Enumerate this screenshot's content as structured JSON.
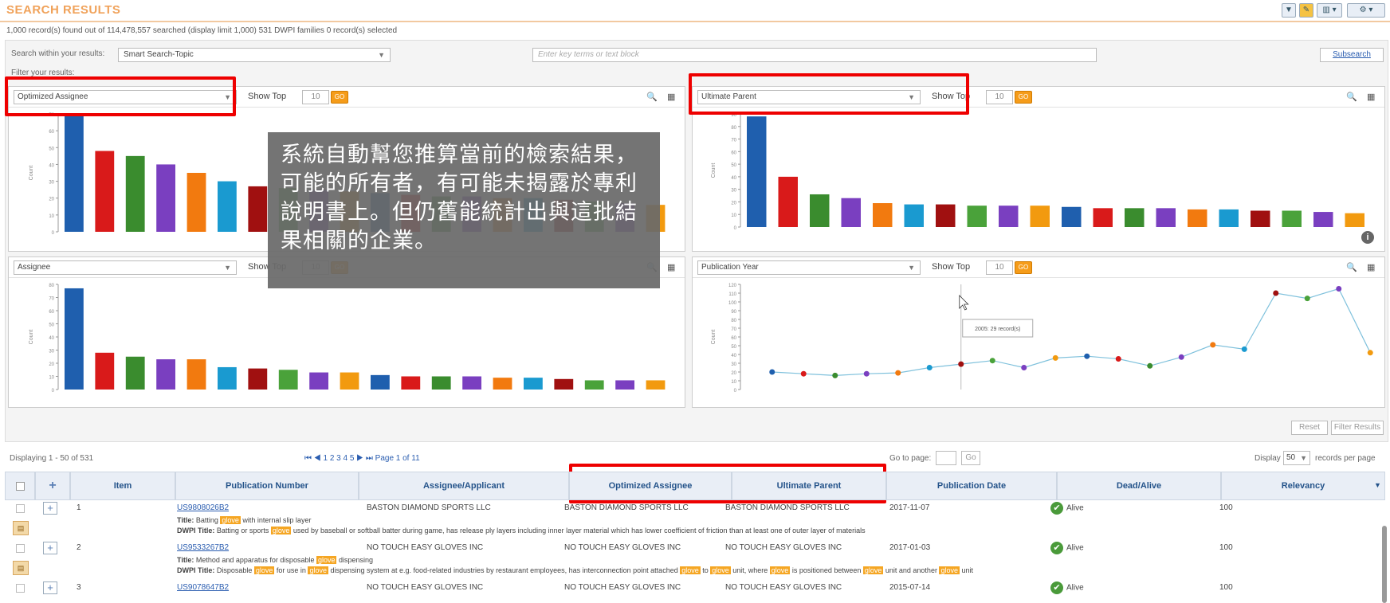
{
  "header": {
    "title": "SEARCH RESULTS",
    "toolbar": [
      "▼",
      "✎",
      "▥ ▾",
      "⚙ ▾"
    ]
  },
  "summary": "1,000 record(s) found out of 114,478,557 searched (display limit 1,000)    531 DWPI families    0 record(s) selected",
  "filters": {
    "search_label": "Search within your results:",
    "search_value": "Smart Search-Topic",
    "terms_placeholder": "Enter key terms or text block",
    "subsearch_label": "Subsearch",
    "filter_label": "Filter your results:",
    "reset": "Reset",
    "filter_results": "Filter Results"
  },
  "charts": [
    {
      "field": "Optimized Assignee",
      "show_top": "Show Top",
      "top_n": "10",
      "ylabel": "Count",
      "yticks": [
        "70",
        "60",
        "50",
        "40",
        "30",
        "20",
        "10",
        "0"
      ]
    },
    {
      "field": "Ultimate Parent",
      "show_top": "Show Top",
      "top_n": "10",
      "ylabel": "Count",
      "yticks": [
        "90",
        "80",
        "70",
        "60",
        "50",
        "40",
        "30",
        "20",
        "10",
        "0"
      ]
    },
    {
      "field": "Assignee",
      "show_top": "Show Top",
      "top_n": "10",
      "ylabel": "Count",
      "yticks": [
        "80",
        "70",
        "60",
        "50",
        "40",
        "30",
        "20",
        "10",
        "0"
      ]
    },
    {
      "field": "Publication Year",
      "show_top": "Show Top",
      "top_n": "10",
      "ylabel": "Count",
      "yticks": [
        "120",
        "110",
        "100",
        "90",
        "80",
        "70",
        "60",
        "50",
        "40",
        "30",
        "20",
        "10",
        "0"
      ],
      "tooltip": "2005: 29 record(s)"
    }
  ],
  "chart_data": [
    {
      "type": "bar",
      "title": "Optimized Assignee",
      "ylabel": "Count",
      "ylim": [
        0,
        70
      ],
      "values": [
        70,
        48,
        45,
        40,
        35,
        30,
        27,
        26,
        25,
        24,
        23,
        22,
        21,
        21,
        20,
        20,
        19,
        18,
        17,
        16
      ],
      "colors": [
        "#1f5fae",
        "#d91a1a",
        "#3a8c2e",
        "#7a3fc0",
        "#f27a0f",
        "#1a9ad0",
        "#a01010",
        "#4aa23a",
        "#7a3fc0",
        "#f29a0f",
        "#1f5fae",
        "#d91a1a",
        "#3a8c2e",
        "#7a3fc0",
        "#f27a0f",
        "#1a9ad0",
        "#a01010",
        "#4aa23a",
        "#7a3fc0",
        "#f29a0f"
      ]
    },
    {
      "type": "bar",
      "title": "Ultimate Parent",
      "ylabel": "Count",
      "ylim": [
        0,
        90
      ],
      "values": [
        88,
        40,
        26,
        23,
        19,
        18,
        18,
        17,
        17,
        17,
        16,
        15,
        15,
        15,
        14,
        14,
        13,
        13,
        12,
        11
      ],
      "colors": [
        "#1f5fae",
        "#d91a1a",
        "#3a8c2e",
        "#7a3fc0",
        "#f27a0f",
        "#1a9ad0",
        "#a01010",
        "#4aa23a",
        "#7a3fc0",
        "#f29a0f",
        "#1f5fae",
        "#d91a1a",
        "#3a8c2e",
        "#7a3fc0",
        "#f27a0f",
        "#1a9ad0",
        "#a01010",
        "#4aa23a",
        "#7a3fc0",
        "#f29a0f"
      ]
    },
    {
      "type": "bar",
      "title": "Assignee",
      "ylabel": "Count",
      "ylim": [
        0,
        80
      ],
      "values": [
        77,
        28,
        25,
        23,
        23,
        17,
        16,
        15,
        13,
        13,
        11,
        10,
        10,
        10,
        9,
        9,
        8,
        7,
        7,
        7
      ],
      "colors": [
        "#1f5fae",
        "#d91a1a",
        "#3a8c2e",
        "#7a3fc0",
        "#f27a0f",
        "#1a9ad0",
        "#a01010",
        "#4aa23a",
        "#7a3fc0",
        "#f29a0f",
        "#1f5fae",
        "#d91a1a",
        "#3a8c2e",
        "#7a3fc0",
        "#f27a0f",
        "#1a9ad0",
        "#a01010",
        "#4aa23a",
        "#7a3fc0",
        "#f29a0f"
      ]
    },
    {
      "type": "line",
      "title": "Publication Year",
      "ylabel": "Count",
      "ylim": [
        0,
        120
      ],
      "values": [
        20,
        18,
        16,
        18,
        19,
        25,
        29,
        33,
        25,
        36,
        38,
        35,
        27,
        37,
        51,
        46,
        110,
        104,
        115,
        42
      ],
      "colors": [
        "#1f5fae",
        "#d91a1a",
        "#3a8c2e",
        "#7a3fc0",
        "#f27a0f",
        "#1a9ad0",
        "#a01010",
        "#4aa23a",
        "#7a3fc0",
        "#f29a0f",
        "#1f5fae",
        "#d91a1a",
        "#3a8c2e",
        "#7a3fc0",
        "#f27a0f",
        "#1a9ad0",
        "#a01010",
        "#4aa23a",
        "#7a3fc0",
        "#f29a0f"
      ]
    }
  ],
  "callout": [
    "系統自動幫您推算當前的檢索結果，",
    "可能的所有者，有可能未揭露於專利",
    "說明書上。但仍舊能統計出與這批結",
    "果相關的企業。"
  ],
  "pager": {
    "displaying": "Displaying 1 - 50 of 531",
    "pages": "⏮ ◀ 1 2 3 4 5 ▶ ⏭  Page 1 of 11",
    "goto": "Go to page:",
    "go": "Go",
    "display": "Display",
    "per_page": "50",
    "records_per_page": "records per page"
  },
  "table": {
    "columns": [
      "Item",
      "Publication Number",
      "Assignee/Applicant",
      "Optimized Assignee",
      "Ultimate Parent",
      "Publication Date",
      "Dead/Alive",
      "Relevancy"
    ],
    "rows": [
      {
        "item": "1",
        "pub": "US9808026B2",
        "assignee": "BASTON DIAMOND SPORTS LLC",
        "opt": "BASTON DIAMOND SPORTS LLC",
        "parent": "BASTON DIAMOND SPORTS LLC",
        "date": "2017-11-07",
        "status": "Alive",
        "rel": "100",
        "title_label": "Title:",
        "title": [
          "Batting ",
          "glove",
          " with internal slip layer"
        ],
        "dwpi_label": "DWPI Title:",
        "dwpi": [
          "Batting or sports ",
          "glove",
          " used by baseball or softball batter during game, has release ply layers including inner layer material which has lower coefficient of friction than at least one of outer layer of materials"
        ]
      },
      {
        "item": "2",
        "pub": "US9533267B2",
        "assignee": "NO TOUCH EASY GLOVES INC",
        "opt": "NO TOUCH EASY GLOVES INC",
        "parent": "NO TOUCH EASY GLOVES INC",
        "date": "2017-01-03",
        "status": "Alive",
        "rel": "100",
        "title_label": "Title:",
        "title": [
          "Method and apparatus for disposable ",
          "glove",
          " dispensing"
        ],
        "dwpi_label": "DWPI Title:",
        "dwpi": [
          "Disposable ",
          "glove",
          " for use in ",
          "glove",
          " dispensing system at e.g. food-related industries by restaurant employees, has interconnection point attached ",
          "glove",
          " to ",
          "glove",
          " unit, where ",
          "glove",
          " is positioned between ",
          "glove",
          " unit and another ",
          "glove",
          " unit"
        ]
      },
      {
        "item": "3",
        "pub": "US9078647B2",
        "assignee": "NO TOUCH EASY GLOVES INC",
        "opt": "NO TOUCH EASY GLOVES INC",
        "parent": "NO TOUCH EASY GLOVES INC",
        "date": "2015-07-14",
        "status": "Alive",
        "rel": "100"
      }
    ]
  }
}
